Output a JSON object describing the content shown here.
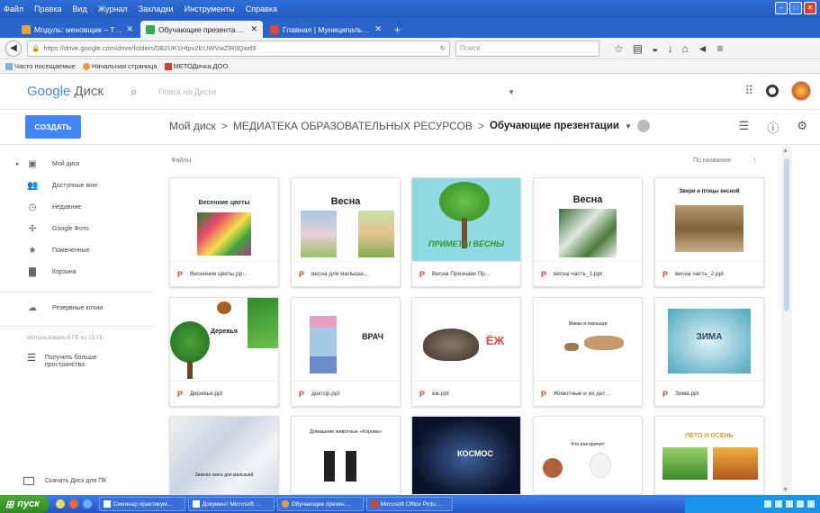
{
  "browser": {
    "menu": [
      "Файл",
      "Правка",
      "Вид",
      "Журнал",
      "Закладки",
      "Инструменты",
      "Справка"
    ],
    "tabs": [
      {
        "label": "Модуль: меновщик – Теми",
        "favicon": "#e8a23a",
        "active": false
      },
      {
        "label": "Обучающие презентации – …",
        "favicon": "#34a853",
        "active": true
      },
      {
        "label": "Главная | Муниципальное б…",
        "favicon": "#d64a3c",
        "active": false
      }
    ],
    "url": "https://drive.google.com/drive/folders/0B2UK1Htpv2lcUWVwZlR0Qwd9",
    "search_placeholder": "Поиск",
    "bookmarks": [
      "Часто посещаемые",
      "Начальная страница",
      "МЕТОДичка.ДОО"
    ]
  },
  "drive": {
    "logo_google": "Google",
    "logo_product": "Диск",
    "search_placeholder": "Поиск на Диске",
    "create_label": "СОЗДАТЬ",
    "breadcrumb": [
      "Мой диск",
      "МЕДИАТЕКА ОБРАЗОВАТЕЛЬНЫХ РЕСУРСОВ",
      "Обучающие презентации"
    ],
    "files_label": "Файлы",
    "sort_label": "По названию"
  },
  "sidebar": {
    "items": [
      {
        "label": "Мой диск",
        "icon": "drive-icon"
      },
      {
        "label": "Доступные мне",
        "icon": "shared-icon"
      },
      {
        "label": "Недавние",
        "icon": "clock-icon"
      },
      {
        "label": "Google Фото",
        "icon": "photos-icon"
      },
      {
        "label": "Помеченные",
        "icon": "star-icon"
      },
      {
        "label": "Корзина",
        "icon": "trash-icon"
      }
    ],
    "backups": "Резервные копии",
    "quota": "Использовано 9 ГБ из 15 ГБ",
    "more_space": "Получить больше пространства",
    "download_pc": "Скачать Диск для ПК"
  },
  "files": [
    {
      "name": "Весенние цветы.pp…",
      "title": "Весенние цветы"
    },
    {
      "name": "весна для малыша…",
      "title": "Весна"
    },
    {
      "name": "Весна Признаки Пр…",
      "title": "ПРИМЕТЫ ВЕСНЫ"
    },
    {
      "name": "весна часть_1.ppt",
      "title": "Весна"
    },
    {
      "name": "весна часть_2.ppt",
      "title": "Звери и птицы весной"
    },
    {
      "name": "Деревья.ppt",
      "title": "Деревья"
    },
    {
      "name": "доктор.ppt",
      "title": "ВРАЧ"
    },
    {
      "name": "еж.ppt",
      "title": "ЁЖ"
    },
    {
      "name": "Животные и их дет…",
      "title": "Мамы и малыши"
    },
    {
      "name": "Зима.ppt",
      "title": "ЗИМА"
    },
    {
      "name": "",
      "title": "Зимняя книга для малышей"
    },
    {
      "name": "",
      "title": "Домашние животные «Корова»"
    },
    {
      "name": "",
      "title": "КОСМОС"
    },
    {
      "name": "",
      "title": "Кто как кричит"
    },
    {
      "name": "",
      "title": "ЛЕТО  И  ОСЕНЬ"
    }
  ],
  "taskbar": {
    "start": "пуск",
    "tasks": [
      "Семинар практикум…",
      "Документ Microsoft …",
      "Обучающие презен…",
      "Microsoft Office Pictu…"
    ]
  },
  "colors": {
    "accent": "#4285f4",
    "ppt": "#d24726"
  }
}
